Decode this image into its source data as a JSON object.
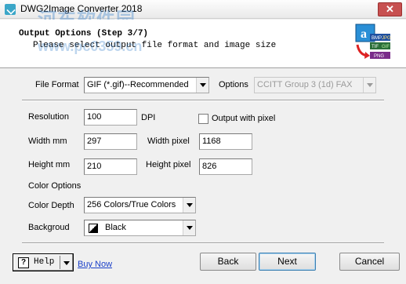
{
  "window": {
    "title": "DWG2Image Converter 2018",
    "watermark": "河东软件园",
    "watermark_url": "www.pc0359.cn",
    "close_label": "✕"
  },
  "header": {
    "title": "Output Options (Step 3/7)",
    "subtitle": "Please select output file format and image size",
    "logo_formats": [
      "BMP",
      "JPG",
      "TIF",
      "GIF",
      "PNG"
    ]
  },
  "format": {
    "label": "File Format",
    "value": "GIF (*.gif)--Recommended",
    "options_label": "Options",
    "options_value": "CCITT Group 3 (1d) FAX"
  },
  "size": {
    "resolution_label": "Resolution",
    "resolution_value": "100",
    "dpi_label": "DPI",
    "output_pixel_label": "Output with pixel",
    "width_mm_label": "Width mm",
    "width_mm_value": "297",
    "width_pixel_label": "Width pixel",
    "width_pixel_value": "1168",
    "height_mm_label": "Height mm",
    "height_mm_value": "210",
    "height_pixel_label": "Height pixel",
    "height_pixel_value": "826"
  },
  "color": {
    "section_label": "Color Options",
    "depth_label": "Color Depth",
    "depth_value": "256 Colors/True Colors",
    "background_label": "Backgroud",
    "background_value": "Black"
  },
  "footer": {
    "help_label": "Help",
    "help_icon": "?",
    "buy_now": "Buy Now",
    "back": "Back",
    "next": "Next",
    "cancel": "Cancel"
  }
}
